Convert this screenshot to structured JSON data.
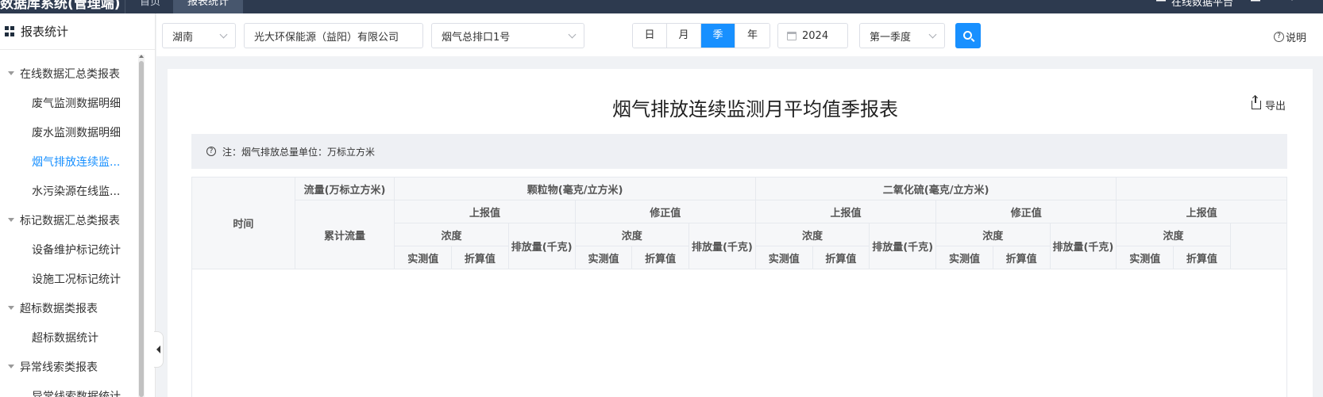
{
  "app": {
    "title": "数据库系统(管理端)"
  },
  "topnav": {
    "tabs": [
      "首页",
      "报表统计"
    ],
    "right_link": "在线数据平台",
    "right_icon1": "user-icon",
    "right_icon2": "menu-icon"
  },
  "sidebar": {
    "title": "报表统计",
    "groups": [
      {
        "label": "在线数据汇总类报表",
        "items": [
          "废气监测数据明细",
          "废水监测数据明细",
          "烟气排放连续监...",
          "水污染源在线监..."
        ]
      },
      {
        "label": "标记数据汇总类报表",
        "items": [
          "设备维护标记统计",
          "设施工况标记统计"
        ]
      },
      {
        "label": "超标数据类报表",
        "items": [
          "超标数据统计"
        ]
      },
      {
        "label": "异常线索类报表",
        "items": [
          "异常线索数据统计"
        ]
      }
    ],
    "active_item": "烟气排放连续监..."
  },
  "filters": {
    "province": "湖南",
    "company": "光大环保能源（益阳）有限公司",
    "outlet": "烟气总排口1号",
    "period_options": [
      "日",
      "月",
      "季",
      "年"
    ],
    "period_selected": "季",
    "year": "2024",
    "quarter": "第一季度",
    "help_label": "说明"
  },
  "report": {
    "title": "烟气排放连续监测月平均值季报表",
    "export_label": "导出",
    "note": "注：烟气排放总量单位：万标立方米",
    "headers": {
      "time": "时间",
      "flow": "流量(万标立方米)",
      "cumulative_flow": "累计流量",
      "particulate": "颗粒物(毫克/立方米)",
      "so2": "二氧化硫(毫克/立方米)",
      "reported": "上报值",
      "corrected": "修正值",
      "concentration": "浓度",
      "emission": "排放量(千克)",
      "measured": "实测值",
      "converted": "折算值"
    }
  },
  "colors": {
    "accent": "#1890ff",
    "nav_bg": "#2d3a4f"
  }
}
